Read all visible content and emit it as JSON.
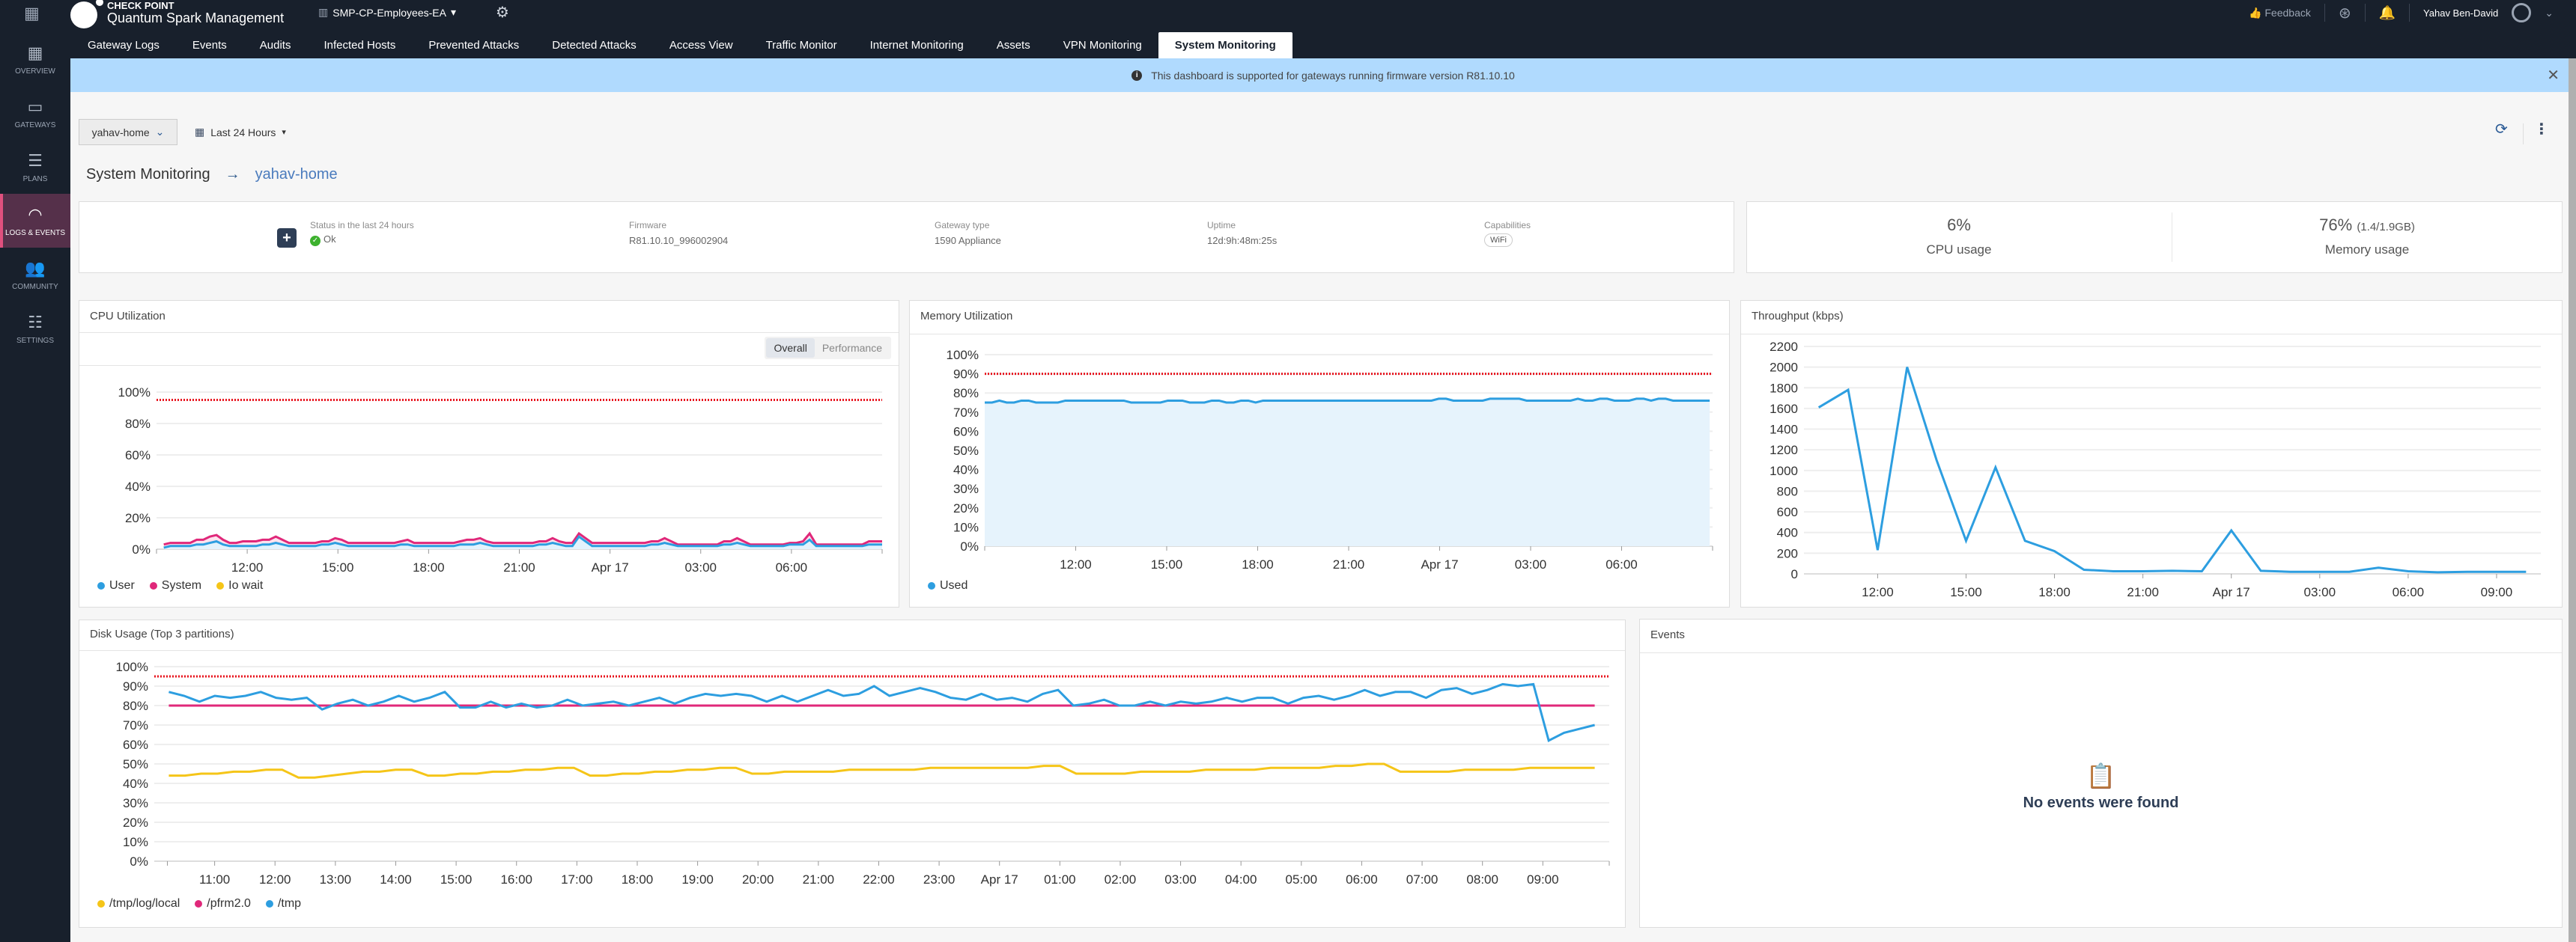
{
  "app": {
    "brand_line1": "CHECK POINT",
    "brand_line2": "Quantum Spark Management",
    "domain": "SMP-CP-Employees-EA",
    "feedback": "Feedback",
    "user": "Yahav Ben-David"
  },
  "tabs": [
    {
      "label": "Gateway Logs",
      "active": false
    },
    {
      "label": "Events",
      "active": false
    },
    {
      "label": "Audits",
      "active": false
    },
    {
      "label": "Infected Hosts",
      "active": false
    },
    {
      "label": "Prevented Attacks",
      "active": false
    },
    {
      "label": "Detected Attacks",
      "active": false
    },
    {
      "label": "Access View",
      "active": false
    },
    {
      "label": "Traffic Monitor",
      "active": false
    },
    {
      "label": "Internet Monitoring",
      "active": false
    },
    {
      "label": "Assets",
      "active": false
    },
    {
      "label": "VPN Monitoring",
      "active": false
    },
    {
      "label": "System Monitoring",
      "active": true
    }
  ],
  "sidebar": [
    {
      "label": "OVERVIEW",
      "icon": "dashboard-icon",
      "glyph": "▦",
      "active": false
    },
    {
      "label": "GATEWAYS",
      "icon": "gateway-icon",
      "glyph": "▭",
      "active": false
    },
    {
      "label": "PLANS",
      "icon": "plans-icon",
      "glyph": "☰",
      "active": false
    },
    {
      "label": "LOGS & EVENTS",
      "icon": "gauge-icon",
      "glyph": "◠",
      "active": true
    },
    {
      "label": "COMMUNITY",
      "icon": "community-icon",
      "glyph": "👥",
      "active": false
    },
    {
      "label": "SETTINGS",
      "icon": "settings-sliders-icon",
      "glyph": "☷",
      "active": false
    }
  ],
  "banner": {
    "text": "This dashboard is supported for gateways running firmware version R81.10.10"
  },
  "controls": {
    "gateway": "yahav-home",
    "time_range": "Last 24 Hours"
  },
  "breadcrumb": {
    "section": "System Monitoring",
    "gateway": "yahav-home"
  },
  "gateway_info": {
    "status_label": "Status in the last 24 hours",
    "status_value": "Ok",
    "firmware_label": "Firmware",
    "firmware_value": "R81.10.10_996002904",
    "type_label": "Gateway type",
    "type_value": "1590 Appliance",
    "uptime_label": "Uptime",
    "uptime_value": "12d:9h:48m:25s",
    "capabilities_label": "Capabilities",
    "capabilities": [
      "WiFi"
    ]
  },
  "usage": {
    "cpu_value": "6%",
    "cpu_label": "CPU usage",
    "mem_value": "76%",
    "mem_detail": "(1.4/1.9GB)",
    "mem_label": "Memory usage"
  },
  "cpu_toggle": {
    "options": [
      "Overall",
      "Performance"
    ],
    "selected": "Overall"
  },
  "events": {
    "title": "Events",
    "empty": "No events were found"
  },
  "chart_data": [
    {
      "id": "cpu",
      "type": "area",
      "title": "CPU Utilization",
      "ylim": [
        0,
        100
      ],
      "yticks": [
        "0%",
        "20%",
        "40%",
        "60%",
        "80%",
        "100%"
      ],
      "ytick_values": [
        0,
        20,
        40,
        60,
        80,
        100
      ],
      "threshold": 95,
      "xticks": [
        "12:00",
        "15:00",
        "18:00",
        "21:00",
        "Apr 17",
        "03:00",
        "06:00"
      ],
      "xtick_positions": [
        0.125,
        0.25,
        0.375,
        0.5,
        0.625,
        0.75,
        0.875
      ],
      "series": [
        {
          "name": "User",
          "color": "#2d9ee0",
          "values": [
            1,
            2,
            2,
            2,
            2,
            3,
            3,
            4,
            5,
            3,
            2,
            2,
            2,
            2,
            2,
            3,
            3,
            4,
            3,
            2,
            2,
            2,
            2,
            2,
            3,
            3,
            4,
            3,
            2,
            2,
            2,
            2,
            2,
            2,
            2,
            2,
            3,
            3,
            2,
            2,
            2,
            2,
            2,
            2,
            2,
            3,
            3,
            3,
            4,
            3,
            2,
            2,
            2,
            2,
            2,
            2,
            2,
            3,
            3,
            4,
            3,
            2,
            2,
            8,
            5,
            2,
            2,
            2,
            2,
            2,
            2,
            2,
            2,
            2,
            3,
            3,
            4,
            3,
            2,
            2,
            2,
            2,
            2,
            2,
            2,
            3,
            3,
            4,
            3,
            2,
            2,
            2,
            2,
            2,
            2,
            3,
            3,
            3,
            6,
            2,
            2,
            2,
            2,
            2,
            2,
            2,
            2,
            3,
            3,
            3
          ]
        },
        {
          "name": "System",
          "color": "#e0287a",
          "values": [
            2,
            2,
            2,
            2,
            2,
            3,
            3,
            4,
            4,
            3,
            2,
            2,
            3,
            3,
            3,
            3,
            3,
            4,
            3,
            2,
            2,
            2,
            2,
            2,
            2,
            2,
            3,
            3,
            2,
            2,
            2,
            2,
            2,
            2,
            2,
            2,
            2,
            3,
            2,
            2,
            2,
            2,
            2,
            2,
            2,
            2,
            3,
            3,
            3,
            2,
            2,
            2,
            2,
            2,
            2,
            2,
            2,
            2,
            2,
            3,
            2,
            2,
            2,
            2,
            2,
            2,
            2,
            2,
            2,
            2,
            2,
            2,
            2,
            2,
            2,
            2,
            3,
            2,
            1,
            1,
            1,
            1,
            1,
            1,
            1,
            2,
            2,
            3,
            2,
            1,
            1,
            1,
            1,
            1,
            1,
            1,
            1,
            2,
            4,
            1,
            1,
            1,
            1,
            1,
            1,
            1,
            1,
            2,
            2,
            2
          ]
        },
        {
          "name": "Io wait",
          "color": "#f5c518",
          "values": []
        }
      ]
    },
    {
      "id": "memory",
      "type": "area",
      "title": "Memory Utilization",
      "ylim": [
        0,
        100
      ],
      "yticks": [
        "0%",
        "10%",
        "20%",
        "30%",
        "40%",
        "50%",
        "60%",
        "70%",
        "80%",
        "90%",
        "100%"
      ],
      "ytick_values": [
        0,
        10,
        20,
        30,
        40,
        50,
        60,
        70,
        80,
        90,
        100
      ],
      "threshold": 90,
      "xticks": [
        "12:00",
        "15:00",
        "18:00",
        "21:00",
        "Apr 17",
        "03:00",
        "06:00"
      ],
      "xtick_positions": [
        0.125,
        0.25,
        0.375,
        0.5,
        0.625,
        0.75,
        0.875
      ],
      "series": [
        {
          "name": "Used",
          "color": "#2d9ee0",
          "values": [
            75,
            75,
            76,
            75,
            75,
            76,
            76,
            75,
            75,
            75,
            75,
            76,
            76,
            76,
            76,
            76,
            76,
            76,
            76,
            76,
            75,
            75,
            75,
            75,
            75,
            76,
            76,
            76,
            75,
            75,
            75,
            76,
            76,
            75,
            75,
            76,
            76,
            75,
            76,
            76,
            76,
            76,
            76,
            76,
            76,
            76,
            76,
            76,
            76,
            76,
            76,
            76,
            76,
            76,
            76,
            76,
            76,
            76,
            76,
            76,
            76,
            76,
            77,
            77,
            76,
            76,
            76,
            76,
            76,
            77,
            77,
            77,
            77,
            77,
            76,
            76,
            76,
            76,
            76,
            76,
            76,
            77,
            76,
            76,
            77,
            77,
            76,
            76,
            76,
            77,
            77,
            76,
            77,
            77,
            76,
            76,
            76,
            76,
            76,
            76
          ]
        }
      ]
    },
    {
      "id": "throughput",
      "type": "line",
      "title": "Throughput (kbps)",
      "ylim": [
        0,
        2200
      ],
      "yticks": [
        "0",
        "200",
        "400",
        "600",
        "800",
        "1000",
        "1200",
        "1400",
        "1600",
        "1800",
        "2000",
        "2200"
      ],
      "ytick_values": [
        0,
        200,
        400,
        600,
        800,
        1000,
        1200,
        1400,
        1600,
        1800,
        2000,
        2200
      ],
      "xticks": [
        "12:00",
        "15:00",
        "18:00",
        "21:00",
        "Apr 17",
        "03:00",
        "06:00",
        "09:00"
      ],
      "xtick_positions": [
        2,
        5,
        8,
        11,
        14,
        17,
        20,
        23
      ],
      "x_range": [
        0,
        24.5
      ],
      "series": [
        {
          "name": "Throughput",
          "color": "#2d9ee0",
          "x": [
            0.5,
            1.5,
            2.5,
            3.5,
            4.5,
            5.5,
            6.5,
            7.5,
            8.5,
            9.5,
            10.5,
            11.5,
            12.5,
            13.5,
            14.5,
            15.5,
            16.5,
            17.5,
            18.5,
            19.5,
            20.5,
            21.5,
            22.5,
            23.5,
            24.5
          ],
          "values": [
            1610,
            1780,
            230,
            2000,
            1100,
            320,
            1030,
            320,
            220,
            40,
            25,
            25,
            30,
            25,
            420,
            30,
            20,
            20,
            20,
            60,
            25,
            15,
            20,
            20,
            20
          ]
        }
      ]
    },
    {
      "id": "disk",
      "type": "line",
      "title": "Disk Usage (Top 3 partitions)",
      "ylim": [
        0,
        100
      ],
      "yticks": [
        "0%",
        "10%",
        "20%",
        "30%",
        "40%",
        "50%",
        "60%",
        "70%",
        "80%",
        "90%",
        "100%"
      ],
      "ytick_values": [
        0,
        10,
        20,
        30,
        40,
        50,
        60,
        70,
        80,
        90,
        100
      ],
      "threshold": 95,
      "xticks": [
        "11:00",
        "12:00",
        "13:00",
        "14:00",
        "15:00",
        "16:00",
        "17:00",
        "18:00",
        "19:00",
        "20:00",
        "21:00",
        "22:00",
        "23:00",
        "Apr 17",
        "01:00",
        "02:00",
        "03:00",
        "04:00",
        "05:00",
        "06:00",
        "07:00",
        "08:00",
        "09:00"
      ],
      "series": [
        {
          "name": "/tmp/log/local",
          "color": "#f5c518",
          "values": [
            44,
            44,
            45,
            45,
            46,
            46,
            47,
            47,
            43,
            43,
            44,
            45,
            46,
            46,
            47,
            47,
            44,
            44,
            45,
            45,
            46,
            46,
            47,
            47,
            48,
            48,
            44,
            44,
            45,
            45,
            46,
            46,
            47,
            47,
            48,
            48,
            45,
            45,
            46,
            46,
            46,
            46,
            47,
            47,
            47,
            47,
            47,
            48,
            48,
            48,
            48,
            48,
            48,
            48,
            49,
            49,
            45,
            45,
            45,
            45,
            46,
            46,
            46,
            46,
            47,
            47,
            47,
            47,
            48,
            48,
            48,
            48,
            49,
            49,
            50,
            50,
            46,
            46,
            46,
            46,
            47,
            47,
            47,
            47,
            48,
            48,
            48,
            48,
            48
          ]
        },
        {
          "name": "/pfrm2.0",
          "color": "#e0287a",
          "values": [
            80,
            80
          ]
        },
        {
          "name": "/tmp",
          "color": "#2d9ee0",
          "values": [
            87,
            85,
            82,
            85,
            84,
            85,
            87,
            84,
            83,
            84,
            78,
            81,
            83,
            80,
            82,
            85,
            82,
            84,
            87,
            79,
            79,
            82,
            79,
            81,
            79,
            80,
            83,
            80,
            81,
            82,
            80,
            82,
            84,
            81,
            84,
            86,
            85,
            86,
            85,
            82,
            85,
            82,
            85,
            88,
            85,
            86,
            90,
            85,
            87,
            89,
            87,
            84,
            83,
            86,
            83,
            84,
            82,
            86,
            88,
            80,
            81,
            83,
            80,
            80,
            82,
            80,
            82,
            81,
            82,
            84,
            82,
            84,
            84,
            81,
            84,
            85,
            83,
            85,
            88,
            85,
            87,
            87,
            84,
            88,
            89,
            86,
            88,
            91,
            90,
            91,
            62,
            66,
            68,
            70
          ]
        }
      ]
    }
  ]
}
